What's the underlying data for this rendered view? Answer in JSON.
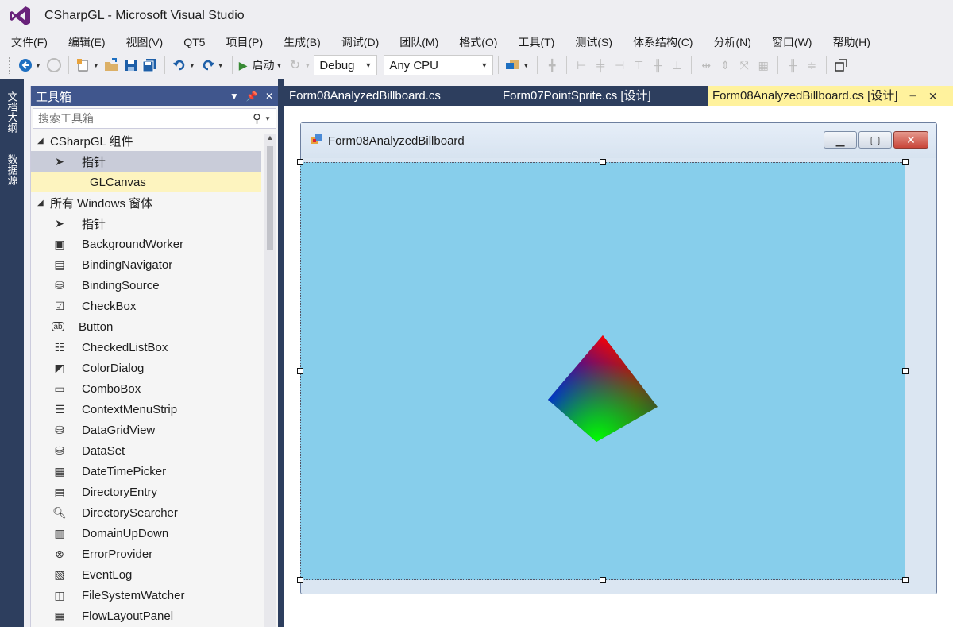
{
  "window": {
    "title": "CSharpGL - Microsoft Visual Studio"
  },
  "menu": [
    "文件(F)",
    "编辑(E)",
    "视图(V)",
    "QT5",
    "项目(P)",
    "生成(B)",
    "调试(D)",
    "团队(M)",
    "格式(O)",
    "工具(T)",
    "测试(S)",
    "体系结构(C)",
    "分析(N)",
    "窗口(W)",
    "帮助(H)"
  ],
  "toolbar": {
    "start_label": "启动",
    "config_value": "Debug",
    "platform_value": "Any CPU"
  },
  "left_tabs": [
    "文档大纲",
    "数据源"
  ],
  "toolbox": {
    "title": "工具箱",
    "search_placeholder": "搜索工具箱",
    "groups": [
      {
        "name": "CSharpGL 组件",
        "items": [
          "指针",
          "GLCanvas"
        ]
      },
      {
        "name": "所有 Windows 窗体",
        "items": [
          "指针",
          "BackgroundWorker",
          "BindingNavigator",
          "BindingSource",
          "CheckBox",
          "Button",
          "CheckedListBox",
          "ColorDialog",
          "ComboBox",
          "ContextMenuStrip",
          "DataGridView",
          "DataSet",
          "DateTimePicker",
          "DirectoryEntry",
          "DirectorySearcher",
          "DomainUpDown",
          "ErrorProvider",
          "EventLog",
          "FileSystemWatcher",
          "FlowLayoutPanel"
        ]
      }
    ]
  },
  "doc_tabs": [
    "Form08AnalyzedBillboard.cs",
    "Form07PointSprite.cs [设计]",
    "Form08AnalyzedBillboard.cs [设计]"
  ],
  "form": {
    "title": "Form08AnalyzedBillboard"
  },
  "colors": {
    "accent": "#40568d",
    "canvas_bg": "#87ceeb",
    "active_tab": "#fff29d",
    "frame": "#2d3e5e"
  }
}
